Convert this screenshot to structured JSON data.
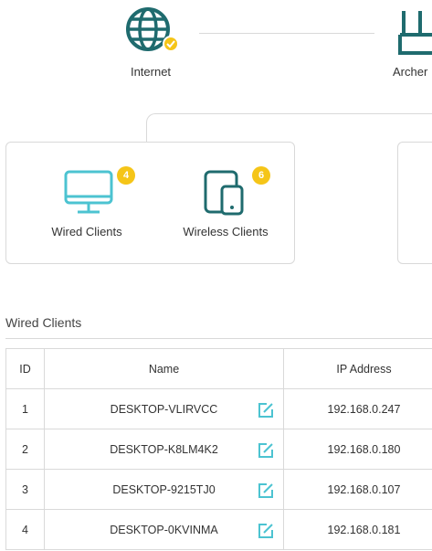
{
  "network_map": {
    "internet_label": "Internet",
    "router_label": "Archer"
  },
  "clients_panel": {
    "wired": {
      "label": "Wired Clients",
      "count": "4"
    },
    "wireless": {
      "label": "Wireless Clients",
      "count": "6"
    }
  },
  "wired_section": {
    "title": "Wired Clients",
    "columns": {
      "id": "ID",
      "name": "Name",
      "ip": "IP Address"
    },
    "rows": [
      {
        "id": "1",
        "name": "DESKTOP-VLIRVCC",
        "ip": "192.168.0.247"
      },
      {
        "id": "2",
        "name": "DESKTOP-K8LM4K2",
        "ip": "192.168.0.180"
      },
      {
        "id": "3",
        "name": "DESKTOP-9215TJ0",
        "ip": "192.168.0.107"
      },
      {
        "id": "4",
        "name": "DESKTOP-0KVINMA",
        "ip": "192.168.0.181"
      }
    ]
  },
  "colors": {
    "accent_teal": "#1f6b6e",
    "icon_cyan": "#4cc3d1",
    "badge_yellow": "#f5c518",
    "border_gray": "#d9d9d9"
  },
  "icons": {
    "internet": "globe-icon",
    "internet_status": "check-badge-icon",
    "router": "router-icon",
    "wired": "monitor-icon",
    "wireless": "tablet-phone-icon",
    "edit": "edit-icon"
  }
}
